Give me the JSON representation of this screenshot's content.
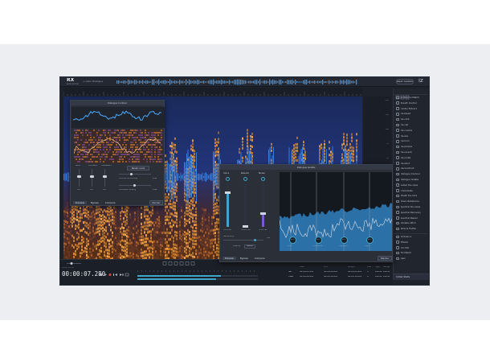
{
  "app": {
    "logo": "RX",
    "logo_sub": "AUDIO EDITOR",
    "file_tab": "+ Cello Dialogue",
    "top_button": "Repair Assistant",
    "izotope_logo": "iz"
  },
  "modules": [
    "Ambience Match",
    "Breath Control",
    "Center Extract",
    "De-bleed",
    "De-click",
    "De-clip",
    "De-crackle",
    "De-ess",
    "De-hum",
    "De-plosive",
    "De-reverb",
    "De-rustle",
    "De-wind",
    "Deconstruct",
    "Dialogue Contour",
    "Dialogue Isolate",
    "Guitar De-noise",
    "Interpolate",
    "Mouth De-click",
    "Music Rebalance",
    "Spectral De-noise",
    "Spectral Recovery",
    "Spectral Repair",
    "Variable Pitch",
    "Wow & Flutter"
  ],
  "right_panel": {
    "history_items": [
      "Ambience",
      "Effects",
      "Dry Mix",
      "EQ Match",
      "Gain"
    ],
    "bottom_label": "Initial State"
  },
  "colors": {
    "accent_blue": "#3fa5c9",
    "spectral_orange": "#e08a2c",
    "spectral_blue": "#3b7fe0",
    "panel_bg": "#1d222b"
  },
  "transport": {
    "timecode_label": "Mono 24 bit",
    "timecode": "00:00:07.280",
    "sel_headers": [
      "Start",
      "End",
      "Length",
      "Low",
      "High",
      "Range"
    ],
    "sel_row1": [
      "Sel",
      "00:00:05.100",
      "00:00:06.000",
      "00:00:00.900",
      "0",
      "22050",
      "22050"
    ],
    "sel_row2": [
      "View",
      "00:00:00.000",
      "00:00:18.024",
      "00:00:18.024",
      "0",
      "22050",
      "22050"
    ]
  },
  "dialogue_contour": {
    "title": "Dialogue Contour",
    "labels": [
      "Pitch",
      "Formant",
      "Transition"
    ],
    "values": [
      "0.0",
      "0.0",
      "0.0"
    ],
    "reset_label": "Reset curve",
    "slider1_label": "Contour smoothing",
    "slider1_value": "2.00",
    "slider2_label": "Intonation scaling",
    "slider2_value": "1.00",
    "tabs": [
      "Preview",
      "Bypass",
      "Compare"
    ],
    "render": "Render"
  },
  "dialogue_isolate": {
    "title": "Dialogue Isolate",
    "channel_labels": [
      "Voice",
      "Reverb",
      "Noise"
    ],
    "channel_values": [
      "+0.0 dB",
      "-100.0 dB",
      "-15.0 dB"
    ],
    "sensitivity_label": "Sensitivity",
    "sensitivity_value": "3.5",
    "quality_label": "Quality",
    "quality_value": "Better",
    "band_labels": [
      "Low",
      "Crossover",
      "High Mid",
      "High"
    ],
    "band_values": [
      "0.0",
      "0.0",
      "0.0",
      "0.0"
    ],
    "tabs": [
      "Preview",
      "Bypass",
      "Compare"
    ],
    "render": "Render"
  }
}
